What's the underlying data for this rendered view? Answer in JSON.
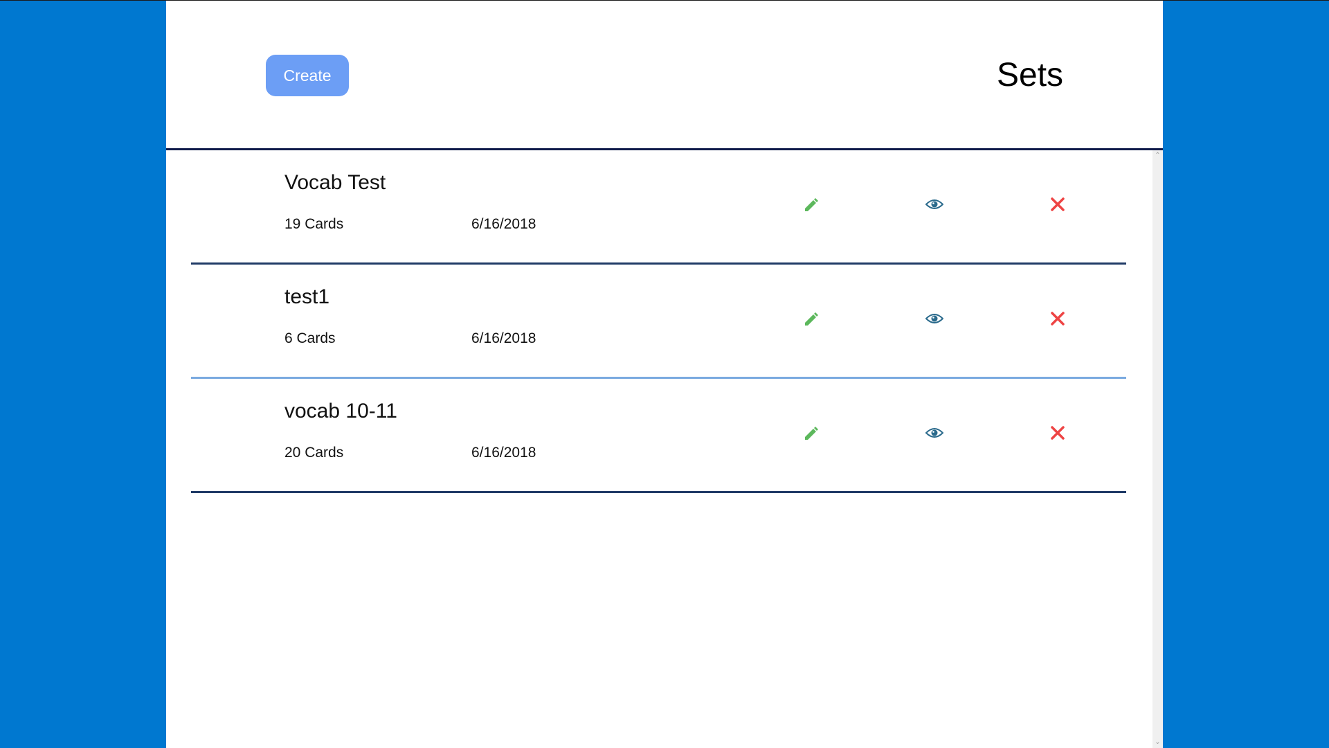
{
  "header": {
    "create_label": "Create",
    "title": "Sets"
  },
  "colors": {
    "background": "#0078d0",
    "create_button": "#6c9ef5",
    "edit_icon": "#5cb85c",
    "view_icon": "#2a6a8c",
    "delete_icon": "#ee4444"
  },
  "sets": [
    {
      "title": "Vocab Test",
      "count": "19 Cards",
      "date": "6/16/2018",
      "divider_color": "#1f3a66"
    },
    {
      "title": "test1",
      "count": "6 Cards",
      "date": "6/16/2018",
      "divider_color": "#7aaae0"
    },
    {
      "title": "vocab 10-11",
      "count": "20 Cards",
      "date": "6/16/2018",
      "divider_color": "#1f3a66"
    }
  ],
  "icons": {
    "edit": "pencil-icon",
    "view": "eye-icon",
    "delete": "close-icon"
  }
}
